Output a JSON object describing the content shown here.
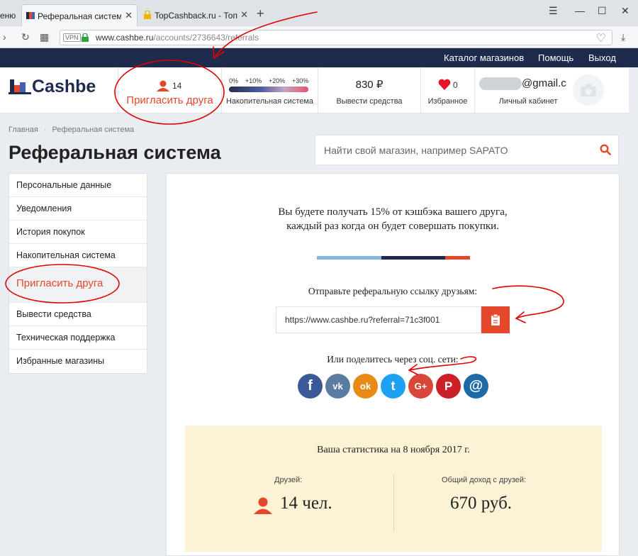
{
  "browser": {
    "menu_label": "еню",
    "tabs": [
      {
        "title": "Реферальная система - С",
        "active": true
      },
      {
        "title": "TopCashback.ru - Топ луч",
        "active": false
      }
    ],
    "url_host": "www.cashbe.ru",
    "url_path": "/accounts/2736643/referrals",
    "vpn_label": "VPN"
  },
  "topnav": {
    "items": [
      "Каталог магазинов",
      "Помощь",
      "Выход"
    ]
  },
  "header": {
    "logo": "Cashbe",
    "friends_count": "14",
    "invite_label": "Пригласить друга",
    "scale_marks": [
      "0%",
      "+10%",
      "+20%",
      "+30%"
    ],
    "scale_label": "Накопительная система",
    "balance": "830 ₽",
    "withdraw_label": "Вывести средства",
    "favorites_count": "0",
    "favorites_label": "Избранное",
    "email_visible": "@gmail.c",
    "cabinet_label": "Личный кабинет"
  },
  "breadcrumbs": [
    "Главная",
    "Реферальная система"
  ],
  "page_title": "Реферальная система",
  "search": {
    "placeholder": "Найти свой магазин, например SAPATO"
  },
  "sidebar": {
    "items": [
      {
        "label": "Персональные данные"
      },
      {
        "label": "Уведомления"
      },
      {
        "label": "История покупок"
      },
      {
        "label": "Накопительная система"
      },
      {
        "label": "Пригласить друга",
        "active": true
      },
      {
        "label": "Вывести средства"
      },
      {
        "label": "Техническая поддержка"
      },
      {
        "label": "Избранные магазины"
      }
    ]
  },
  "main": {
    "intro_line1": "Вы будете получать 15% от кэшбэка вашего друга,",
    "intro_line2": "каждый раз когда он будет совершать покупки.",
    "send_label": "Отправьте реферальную ссылку друзьям:",
    "ref_link": "https://www.cashbe.ru?referral=71c3f001",
    "share_label": "Или поделитесь через соц. сети:",
    "social": [
      {
        "name": "facebook",
        "glyph": "f",
        "color": "#3b5998"
      },
      {
        "name": "vk",
        "glyph": "vk",
        "color": "#5a7ca0"
      },
      {
        "name": "odnoklassniki",
        "glyph": "ok",
        "color": "#e78b16"
      },
      {
        "name": "twitter",
        "glyph": "t",
        "color": "#1da1f2"
      },
      {
        "name": "google-plus",
        "glyph": "G+",
        "color": "#d9473a"
      },
      {
        "name": "pinterest",
        "glyph": "P",
        "color": "#cb2027"
      },
      {
        "name": "email",
        "glyph": "@",
        "color": "#1d6aa8"
      }
    ],
    "stats": {
      "title": "Ваша статистика на 8 ноября 2017 г.",
      "friends_label": "Друзей:",
      "friends_value": "14 чел.",
      "income_label": "Общий доход с друзей:",
      "income_value": "670 руб."
    }
  },
  "colors": {
    "brand_dark": "#1f2b4d",
    "accent": "#e4472a",
    "stats_bg": "#fcf3d6",
    "annotation": "#e00000"
  }
}
